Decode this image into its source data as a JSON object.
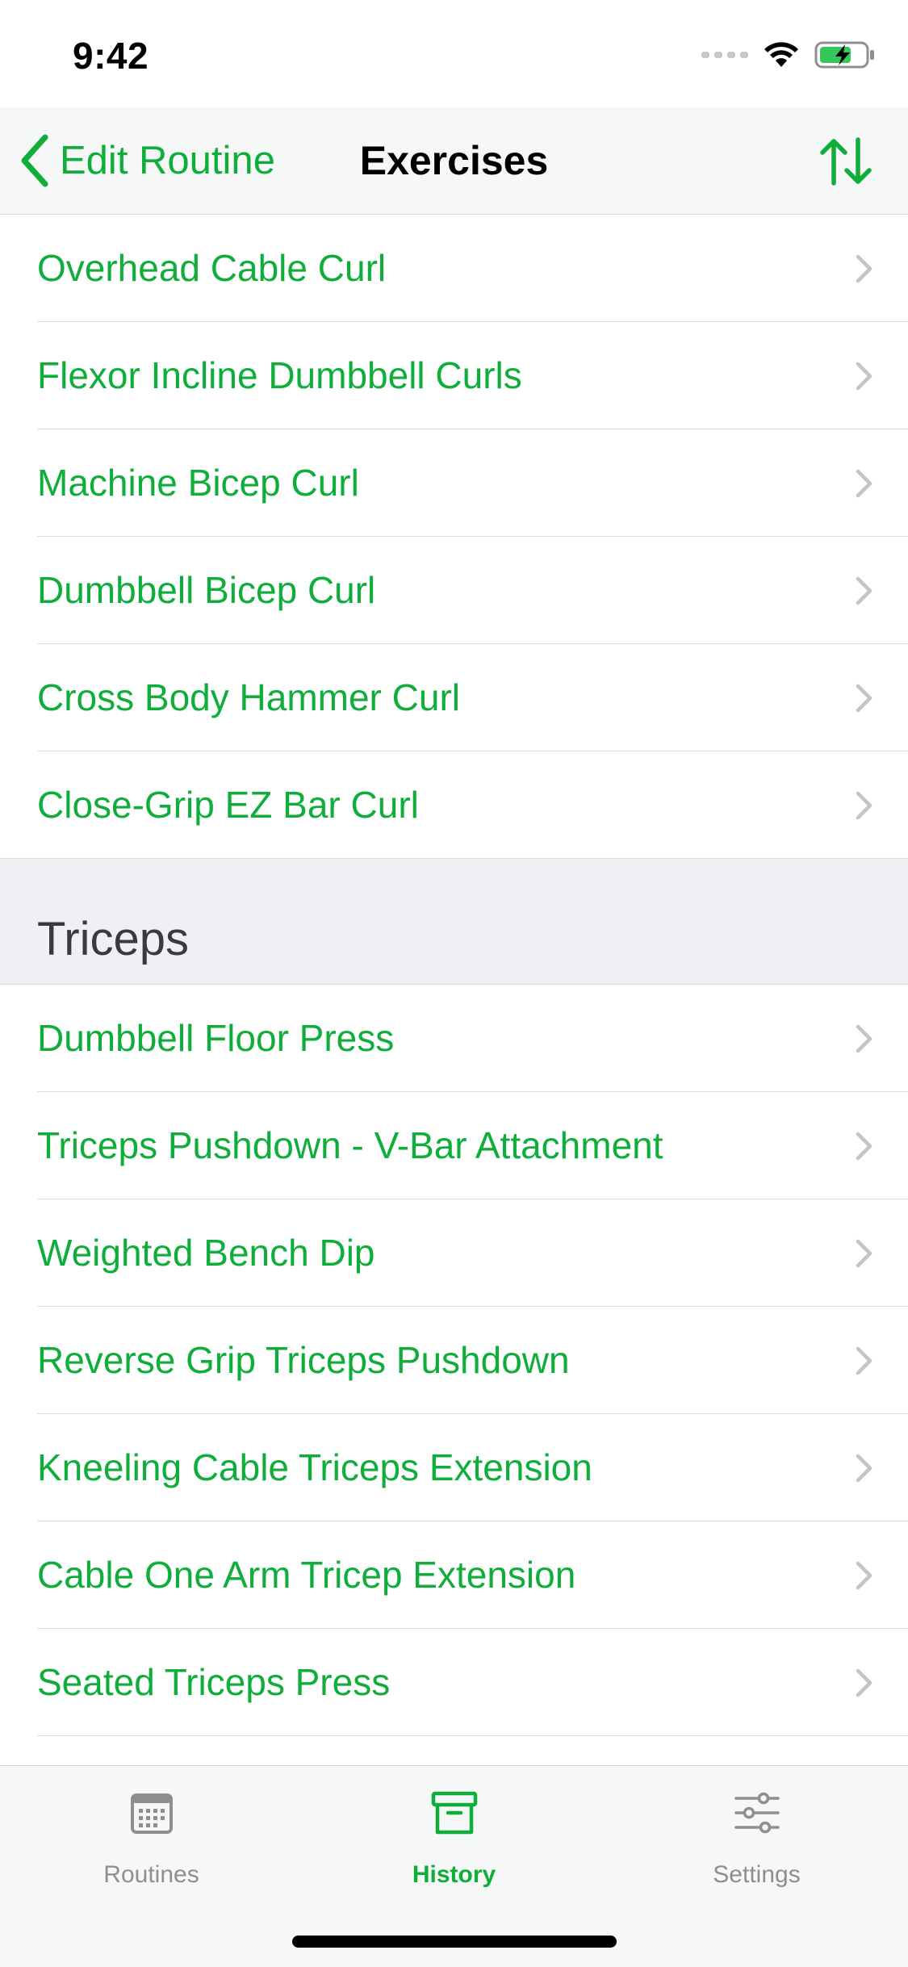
{
  "status_bar": {
    "time": "9:42"
  },
  "nav": {
    "back_label": "Edit Routine",
    "title": "Exercises"
  },
  "sections": [
    {
      "title": "",
      "items": [
        {
          "label": "Overhead Cable Curl"
        },
        {
          "label": "Flexor Incline Dumbbell Curls"
        },
        {
          "label": "Machine Bicep Curl"
        },
        {
          "label": "Dumbbell Bicep Curl"
        },
        {
          "label": "Cross Body Hammer Curl"
        },
        {
          "label": "Close-Grip EZ Bar Curl"
        }
      ]
    },
    {
      "title": "Triceps",
      "items": [
        {
          "label": "Dumbbell Floor Press"
        },
        {
          "label": "Triceps Pushdown - V-Bar Attachment"
        },
        {
          "label": "Weighted Bench Dip"
        },
        {
          "label": "Reverse Grip Triceps Pushdown"
        },
        {
          "label": "Kneeling Cable Triceps Extension"
        },
        {
          "label": "Cable One Arm Tricep Extension"
        },
        {
          "label": "Seated Triceps Press"
        }
      ]
    }
  ],
  "tabs": [
    {
      "label": "Routines",
      "icon": "calendar-icon",
      "active": false
    },
    {
      "label": "History",
      "icon": "archive-box-icon",
      "active": true
    },
    {
      "label": "Settings",
      "icon": "sliders-icon",
      "active": false
    }
  ],
  "colors": {
    "accent": "#0fae3a",
    "inactive": "#8e8e93",
    "section_bg": "#f0f0f4"
  }
}
